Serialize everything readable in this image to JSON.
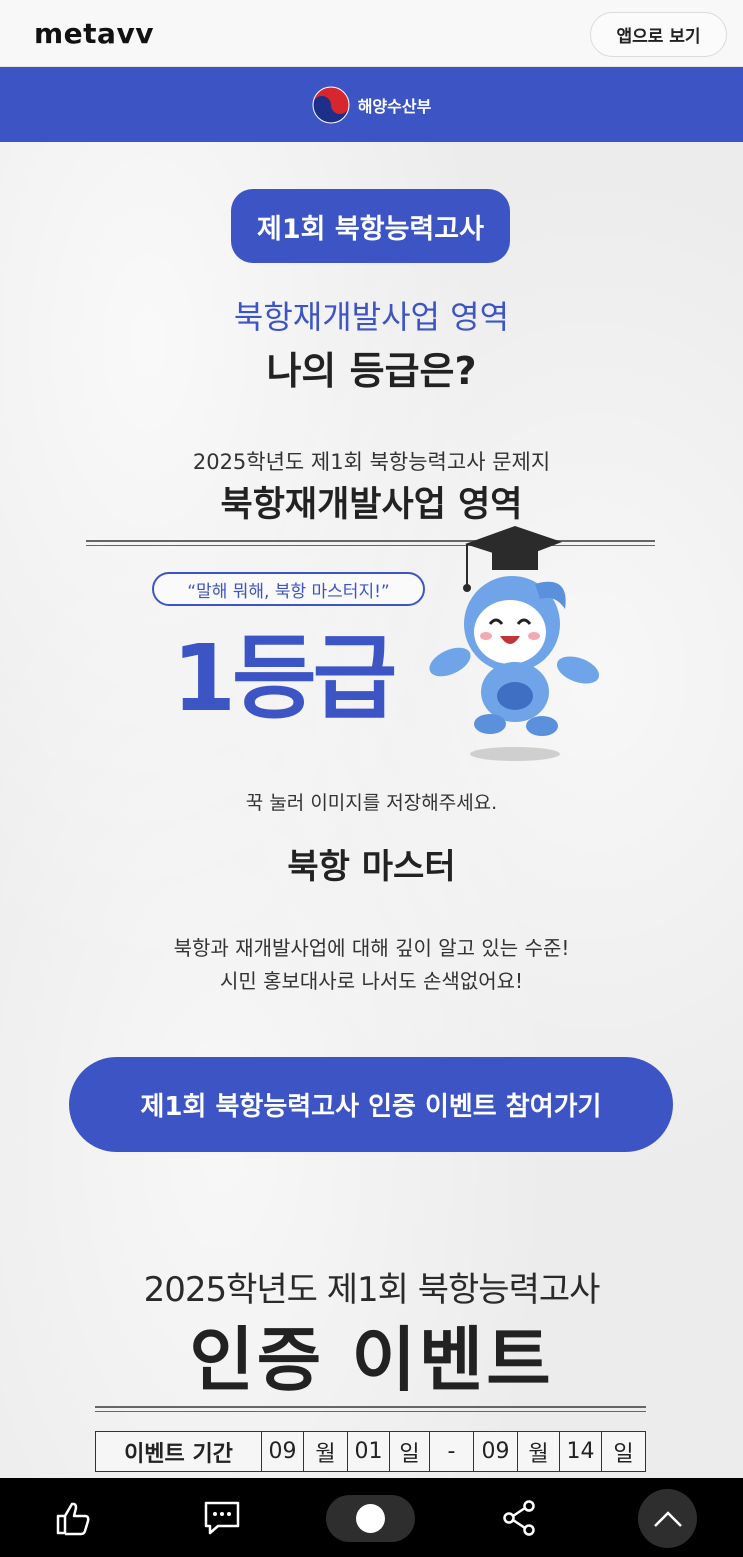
{
  "header": {
    "logo": "metavv",
    "app_button_label": "앱으로 보기"
  },
  "gov_banner": {
    "name": "해양수산부"
  },
  "result": {
    "pill_title": "제1회 북항능력고사",
    "subtitle": "북항재개발사업 영역",
    "question": "나의 등급은?",
    "exam_line": "2025학년도 제1회 북항능력고사 문제지",
    "exam_area": "북항재개발사업 영역",
    "quote": "“말해 뭐해, 북항 마스터지!”",
    "grade": "1등급",
    "save_hint": "꾹 눌러 이미지를 저장해주세요.",
    "title": "북항 마스터",
    "description_line1": "북항과 재개발사업에 대해 깊이 알고 있는 수준!",
    "description_line2": "시민 홍보대사로 나서도 손색없어요!",
    "event_button_label": "제1회 북항능력고사 인증 이벤트 참여가기"
  },
  "event": {
    "year_line": "2025학년도 제1회 북항능력고사",
    "title": "인증 이벤트",
    "period": {
      "label": "이벤트 기간",
      "start_month": "09",
      "month_unit": "월",
      "start_day": "01",
      "day_unit": "일",
      "separator": "-",
      "end_month": "09",
      "end_day": "14"
    }
  },
  "colors": {
    "accent": "#3d55c4",
    "nav_background": "#000000"
  },
  "bottom_nav": {
    "icons": [
      "thumbs-up-icon",
      "comment-icon",
      "toggle-switch",
      "share-icon",
      "chevron-up-icon"
    ]
  }
}
